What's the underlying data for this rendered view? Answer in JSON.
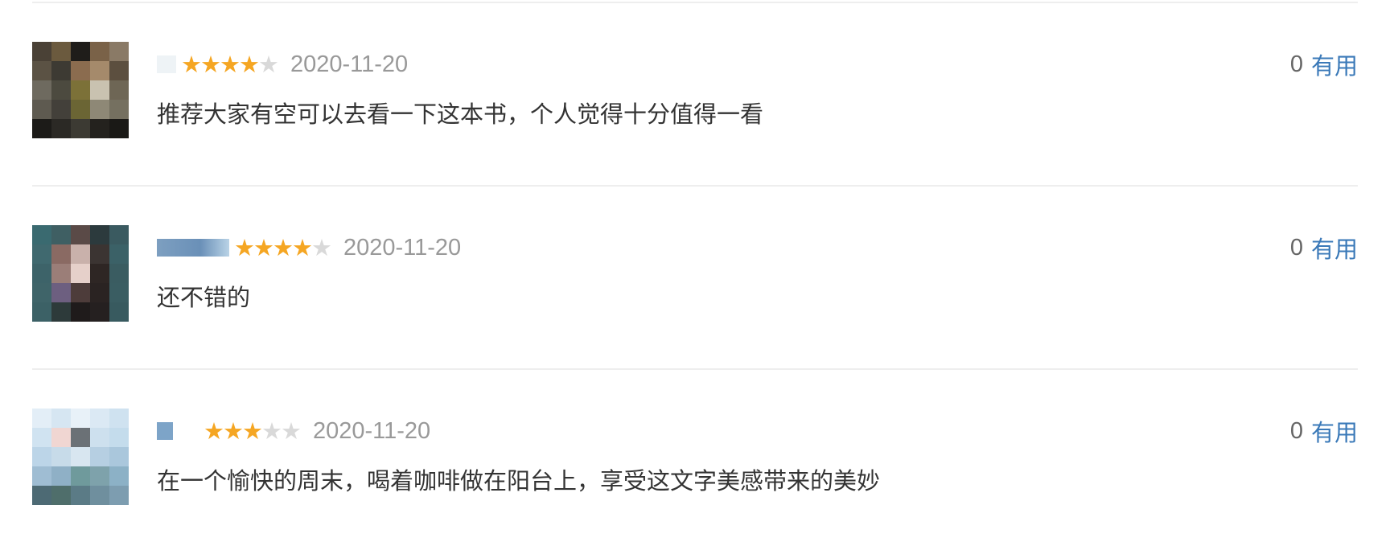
{
  "reviews": [
    {
      "rating": 4,
      "max_rating": 5,
      "date": "2020-11-20",
      "comment": "推荐大家有空可以去看一下这本书，个人觉得十分值得一看",
      "useful_count": "0",
      "useful_label": "有用"
    },
    {
      "rating": 4,
      "max_rating": 5,
      "date": "2020-11-20",
      "comment": "还不错的",
      "useful_count": "0",
      "useful_label": "有用"
    },
    {
      "rating": 3,
      "max_rating": 5,
      "date": "2020-11-20",
      "comment": "在一个愉快的周末，喝着咖啡做在阳台上，享受这文字美感带来的美妙",
      "useful_count": "0",
      "useful_label": "有用"
    }
  ],
  "colors": {
    "star_on": "#f5a623",
    "star_off": "#d9d9d9",
    "date": "#999999",
    "comment": "#333333",
    "useful_link": "#3a79b8",
    "divider": "#eeeeee"
  },
  "icons": {
    "star": "star-icon"
  }
}
